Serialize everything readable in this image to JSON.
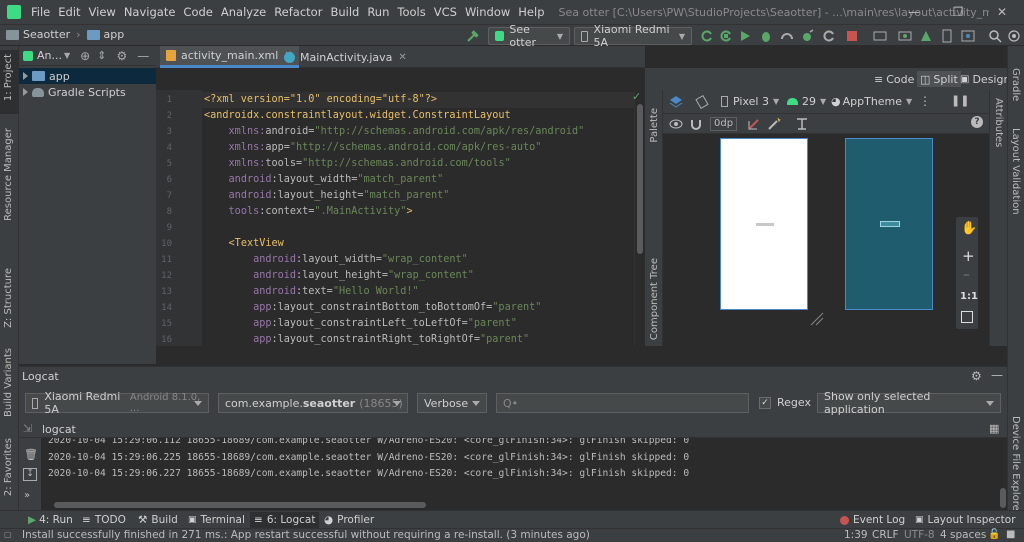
{
  "menubar": {
    "items": [
      "File",
      "Edit",
      "View",
      "Navigate",
      "Code",
      "Analyze",
      "Refactor",
      "Build",
      "Run",
      "Tools",
      "VCS",
      "Window",
      "Help"
    ],
    "title": "Sea otter [C:\\Users\\PW\\StudioProjects\\Seaotter] - ...\\main\\res\\layout\\activity_main.xml [app]"
  },
  "toolbar": {
    "crumb_project": "Seaotter",
    "crumb_module": "app",
    "run_config": "See otter",
    "device": "Xiaomi Redmi 5A"
  },
  "left_strip": {
    "project": "1: Project",
    "resource_manager": "Resource Manager",
    "structure": "Z: Structure",
    "build_variants": "Build Variants",
    "favorites": "2: Favorites"
  },
  "project_panel": {
    "view_label": "An...",
    "items": [
      {
        "label": "app"
      },
      {
        "label": "Gradle Scripts"
      }
    ]
  },
  "editor": {
    "tabs": [
      {
        "label": "activity_main.xml"
      },
      {
        "label": "MainActivity.java"
      }
    ],
    "line_numbers": [
      "1",
      "2",
      "3",
      "4",
      "5",
      "6",
      "7",
      "8",
      "9",
      "10",
      "11",
      "12",
      "13",
      "14",
      "15",
      "16"
    ],
    "lines": [
      [
        [
          "pi",
          "<?xml version=\"1.0\" encoding=\"utf-8\"?>"
        ]
      ],
      [
        [
          "tag",
          "<androidx.constraintlayout.widget.ConstraintLayout"
        ]
      ],
      [
        [
          "attr",
          "    "
        ],
        [
          "ns",
          "xmlns:"
        ],
        [
          "attr",
          "android"
        ],
        [
          "attr",
          "="
        ],
        [
          "val",
          "\"http://schemas.android.com/apk/res/android\""
        ]
      ],
      [
        [
          "attr",
          "    "
        ],
        [
          "ns",
          "xmlns:"
        ],
        [
          "attr",
          "app"
        ],
        [
          "attr",
          "="
        ],
        [
          "val",
          "\"http://schemas.android.com/apk/res-auto\""
        ]
      ],
      [
        [
          "attr",
          "    "
        ],
        [
          "ns",
          "xmlns:"
        ],
        [
          "attr",
          "tools"
        ],
        [
          "attr",
          "="
        ],
        [
          "val",
          "\"http://schemas.android.com/tools\""
        ]
      ],
      [
        [
          "attr",
          "    "
        ],
        [
          "ns",
          "android"
        ],
        [
          "attr",
          ":layout_width="
        ],
        [
          "val",
          "\"match_parent\""
        ]
      ],
      [
        [
          "attr",
          "    "
        ],
        [
          "ns",
          "android"
        ],
        [
          "attr",
          ":layout_height="
        ],
        [
          "val",
          "\"match_parent\""
        ]
      ],
      [
        [
          "attr",
          "    "
        ],
        [
          "ns",
          "tools"
        ],
        [
          "attr",
          ":context="
        ],
        [
          "val",
          "\".MainActivity\""
        ],
        [
          "tag",
          ">"
        ]
      ],
      [
        [
          "attr",
          ""
        ]
      ],
      [
        [
          "attr",
          "    "
        ],
        [
          "tag",
          "<TextView"
        ]
      ],
      [
        [
          "attr",
          "        "
        ],
        [
          "ns",
          "android"
        ],
        [
          "attr",
          ":layout_width="
        ],
        [
          "val",
          "\"wrap_content\""
        ]
      ],
      [
        [
          "attr",
          "        "
        ],
        [
          "ns",
          "android"
        ],
        [
          "attr",
          ":layout_height="
        ],
        [
          "val",
          "\"wrap_content\""
        ]
      ],
      [
        [
          "attr",
          "        "
        ],
        [
          "ns",
          "android"
        ],
        [
          "attr",
          ":text="
        ],
        [
          "val",
          "\"Hello World!\""
        ]
      ],
      [
        [
          "attr",
          "        "
        ],
        [
          "ns",
          "app"
        ],
        [
          "attr",
          ":layout_constraintBottom_toBottomOf="
        ],
        [
          "val",
          "\"parent\""
        ]
      ],
      [
        [
          "attr",
          "        "
        ],
        [
          "ns",
          "app"
        ],
        [
          "attr",
          ":layout_constraintLeft_toLeftOf="
        ],
        [
          "val",
          "\"parent\""
        ]
      ],
      [
        [
          "attr",
          "        "
        ],
        [
          "ns",
          "app"
        ],
        [
          "attr",
          ":layout_constraintRight_toRightOf="
        ],
        [
          "val",
          "\"parent\""
        ]
      ]
    ]
  },
  "view_mode": {
    "code": "Code",
    "split": "Split",
    "design": "Design"
  },
  "design": {
    "palette": "Palette",
    "component_tree": "Component Tree",
    "attributes": "Attributes",
    "device": "Pixel 3",
    "api": "29",
    "theme": "AppTheme",
    "margin": "0dp",
    "zoom_fit": "1:1"
  },
  "right_strip": {
    "gradle": "Gradle",
    "layout_validation": "Layout Validation",
    "device_file_explorer": "Device File Explorer"
  },
  "logcat": {
    "title": "Logcat",
    "device": "Xiaomi Redmi 5A",
    "device_detail": "Android 8.1.0, ...",
    "process": "com.example.",
    "process_bold": "seaotter",
    "process_pid": "(18655)",
    "level": "Verbose",
    "search_placeholder": "Q•",
    "regex": "Regex",
    "filter": "Show only selected application",
    "subtab": "logcat",
    "lines": [
      "2020-10-04 15:29:06.112 18655-18689/com.example.seaotter W/Adreno-ES20: <core_glFinish:34>: glFinish skipped: 0",
      "2020-10-04 15:29:06.225 18655-18689/com.example.seaotter W/Adreno-ES20: <core_glFinish:34>: glFinish skipped: 0",
      "2020-10-04 15:29:06.227 18655-18689/com.example.seaotter W/Adreno-ES20: <core_glFinish:34>: glFinish skipped: 0"
    ]
  },
  "bottom_tabs": {
    "run": "4: Run",
    "todo": "TODO",
    "build": "Build",
    "terminal": "Terminal",
    "logcat": "6: Logcat",
    "profiler": "Profiler",
    "event_log": "Event Log",
    "layout_inspector": "Layout Inspector"
  },
  "status": {
    "message": "Install successfully finished in 271 ms.: App restart successful without requiring a re-install. (3 minutes ago)",
    "position": "1:39",
    "line_sep": "CRLF",
    "encoding": "UTF-8",
    "indent": "4 spaces"
  },
  "colors": {
    "accent": "#4a88c7",
    "android_green": "#3ddc84",
    "canvas_blue": "#1f5d6e"
  }
}
